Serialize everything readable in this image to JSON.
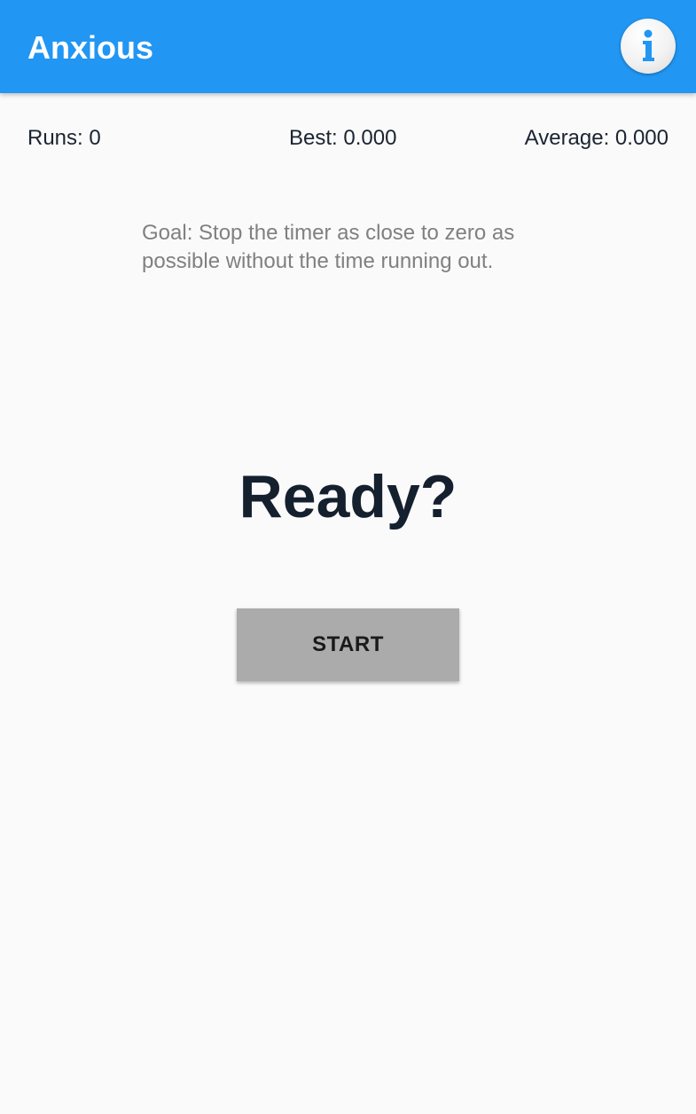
{
  "app_bar": {
    "title": "Anxious",
    "info_icon": "info-icon",
    "color": "#2196F3"
  },
  "stats": {
    "runs": "Runs: 0",
    "best": "Best: 0.000",
    "average": "Average: 0.000"
  },
  "goal_text": "Goal: Stop the timer as close to zero as possible without the time running out.",
  "status_text": "Ready?",
  "start_button": {
    "label": "START",
    "color": "#ABABAB"
  }
}
